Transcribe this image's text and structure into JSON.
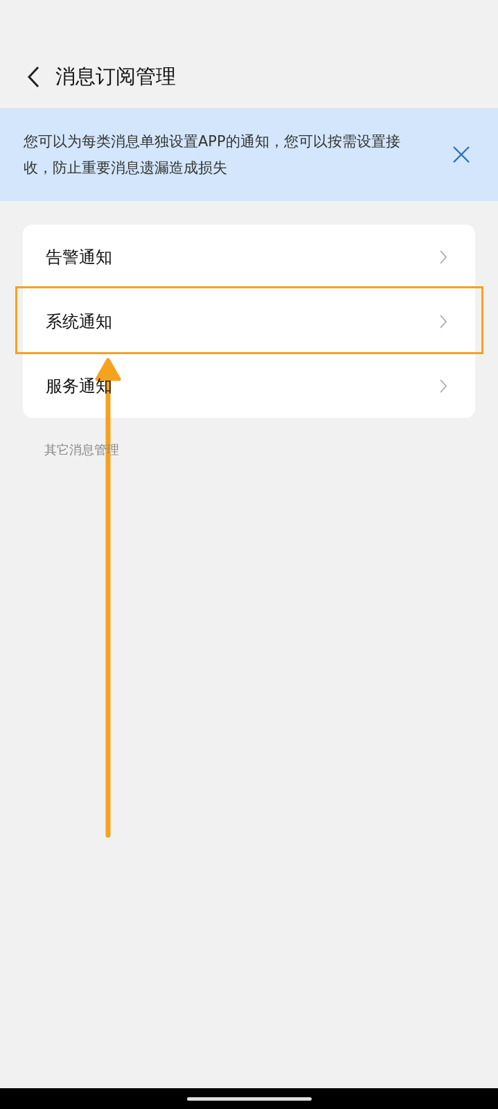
{
  "header": {
    "title": "消息订阅管理"
  },
  "banner": {
    "text": "您可以为每类消息单独设置APP的通知，您可以按需设置接收，防止重要消息遗漏造成损失"
  },
  "items": [
    {
      "label": "告警通知"
    },
    {
      "label": "系统通知"
    },
    {
      "label": "服务通知"
    }
  ],
  "section_label": "其它消息管理"
}
